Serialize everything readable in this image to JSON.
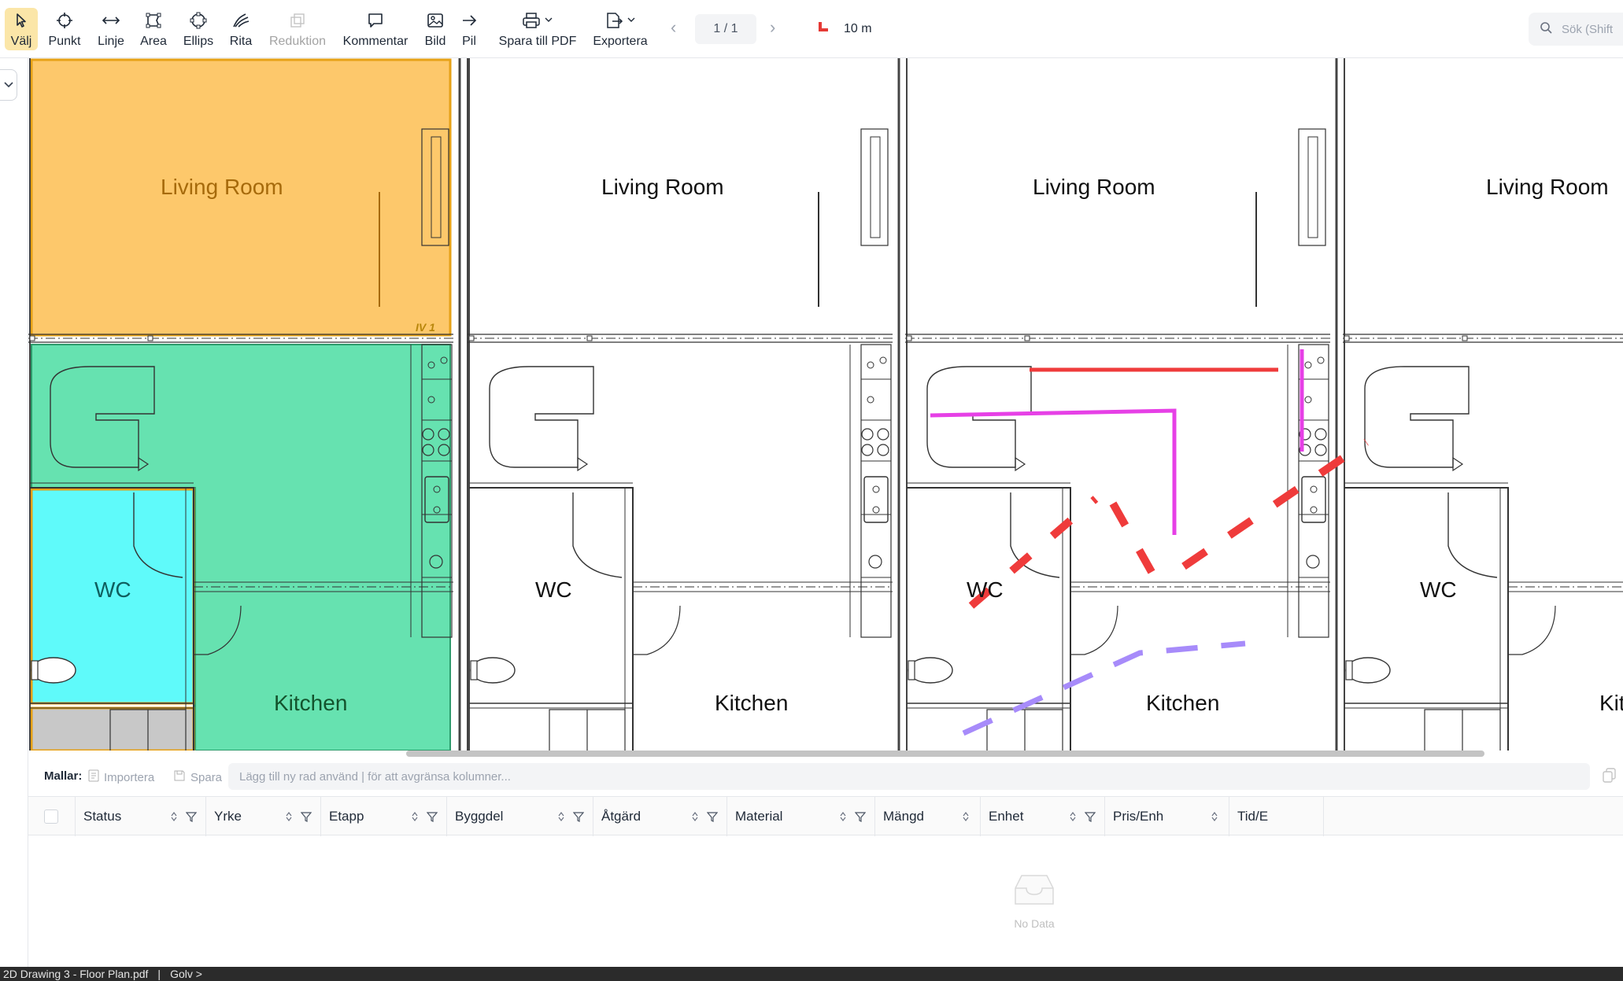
{
  "toolbar": {
    "tools": [
      {
        "id": "select",
        "label": "Välj",
        "icon": "cursor-icon",
        "active": true
      },
      {
        "id": "point",
        "label": "Punkt",
        "icon": "crosshair-icon"
      },
      {
        "id": "line",
        "label": "Linje",
        "icon": "double-arrow-icon"
      },
      {
        "id": "area",
        "label": "Area",
        "icon": "polygon-icon"
      },
      {
        "id": "ellipse",
        "label": "Ellips",
        "icon": "ellipse-icon"
      },
      {
        "id": "draw",
        "label": "Rita",
        "icon": "freehand-icon"
      },
      {
        "id": "reduction",
        "label": "Reduktion",
        "icon": "reduction-icon",
        "disabled": true
      },
      {
        "id": "comment",
        "label": "Kommentar",
        "icon": "comment-icon"
      },
      {
        "id": "image",
        "label": "Bild",
        "icon": "image-icon"
      },
      {
        "id": "arrow",
        "label": "Pil",
        "icon": "arrow-icon"
      },
      {
        "id": "save-pdf",
        "label": "Spara till PDF",
        "icon": "printer-icon"
      },
      {
        "id": "export",
        "label": "Exportera",
        "icon": "export-icon"
      }
    ],
    "page_indicator": "1 / 1",
    "scale_label": "10 m",
    "search_placeholder": "Sök (Shift"
  },
  "drawing": {
    "rooms": [
      {
        "label": "Living Room"
      },
      {
        "label": "WC"
      },
      {
        "label": "Kitchen"
      },
      {
        "label": "Living Room"
      },
      {
        "label": "WC"
      },
      {
        "label": "Kitchen"
      },
      {
        "label": "Living Room"
      },
      {
        "label": "WC"
      },
      {
        "label": "Kitchen"
      },
      {
        "label": "Living Room"
      },
      {
        "label": "WC"
      },
      {
        "label": "Kit"
      }
    ],
    "tag": "IV 1",
    "colors": {
      "living_fill": "#fdc86b",
      "living_stroke": "#e6a116",
      "kitchen_fill": "#66e2b0",
      "wc_fill": "#5ffafa",
      "red_line": "#ef3b3b",
      "magenta_line": "#e640e6",
      "purple_line": "#a78bfa"
    }
  },
  "panel": {
    "templates_label": "Mallar:",
    "import_label": "Importera",
    "save_label": "Spara",
    "columns_placeholder": "Lägg till ny rad använd | för att avgränsa kolumner...",
    "columns": [
      {
        "label": "Status",
        "filter": true
      },
      {
        "label": "Yrke",
        "filter": true
      },
      {
        "label": "Etapp",
        "filter": true
      },
      {
        "label": "Byggdel",
        "filter": true
      },
      {
        "label": "Åtgärd",
        "filter": true
      },
      {
        "label": "Material",
        "filter": true
      },
      {
        "label": "Mängd",
        "filter": false
      },
      {
        "label": "Enhet",
        "filter": true
      },
      {
        "label": "Pris/Enh",
        "filter": false
      },
      {
        "label": "Tid/E",
        "filter": false
      }
    ],
    "empty_text": "No Data"
  },
  "statusbar": {
    "file": "2D Drawing 3 - Floor Plan.pdf",
    "separator": "|",
    "crumb": "Golv >"
  }
}
